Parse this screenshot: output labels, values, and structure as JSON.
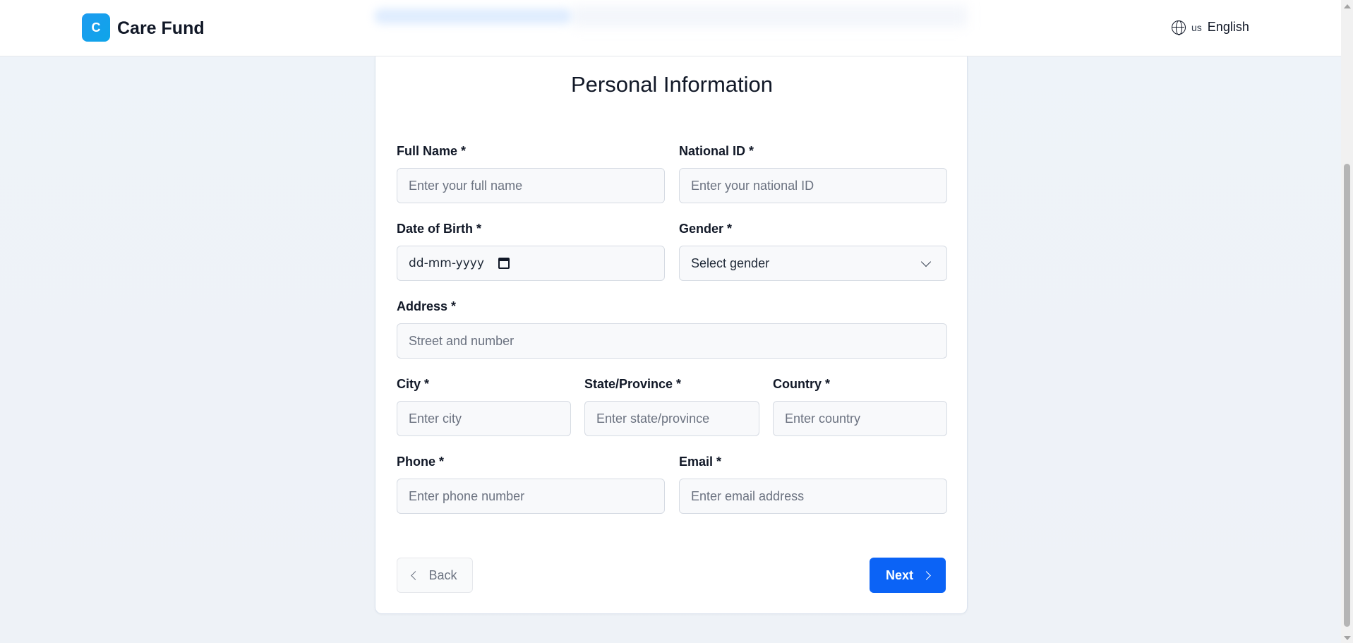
{
  "header": {
    "logo_letter": "C",
    "brand": "Care Fund",
    "language_flag": "us",
    "language": "English"
  },
  "form": {
    "title": "Personal Information",
    "full_name": {
      "label": "Full Name *",
      "placeholder": "Enter your full name"
    },
    "national_id": {
      "label": "National ID *",
      "placeholder": "Enter your national ID"
    },
    "dob": {
      "label": "Date of Birth *",
      "placeholder": "dd-mm-yyyy"
    },
    "gender": {
      "label": "Gender *",
      "selected": "Select gender"
    },
    "address": {
      "label": "Address *",
      "placeholder": "Street and number"
    },
    "city": {
      "label": "City *",
      "placeholder": "Enter city"
    },
    "state": {
      "label": "State/Province *",
      "placeholder": "Enter state/province"
    },
    "country": {
      "label": "Country *",
      "placeholder": "Enter country"
    },
    "phone": {
      "label": "Phone *",
      "placeholder": "Enter phone number"
    },
    "email": {
      "label": "Email *",
      "placeholder": "Enter email address"
    },
    "back_label": "Back",
    "next_label": "Next"
  },
  "colors": {
    "primary": "#0b63f6",
    "logo_gradient_start": "#1d9bf0",
    "input_bg": "#f8f9fb"
  }
}
